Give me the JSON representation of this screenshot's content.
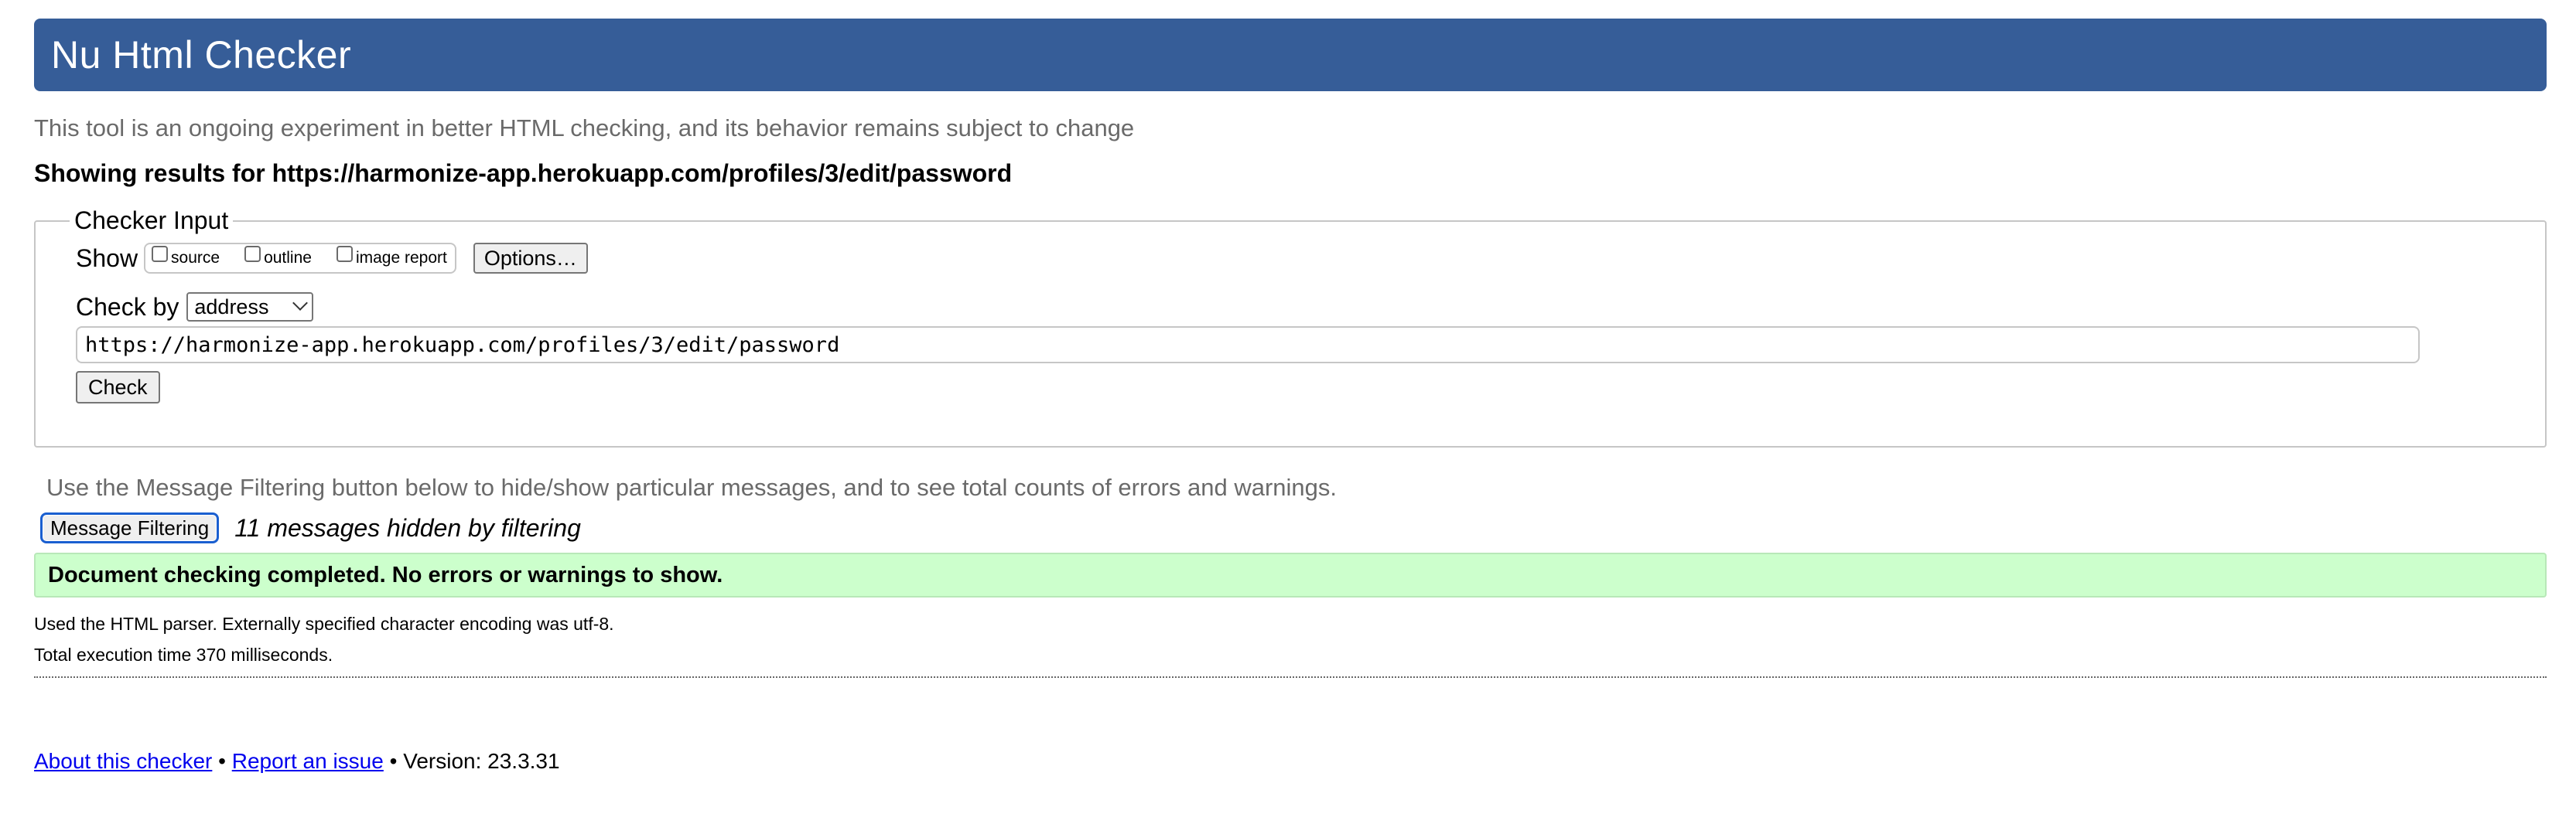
{
  "header": {
    "title": "Nu Html Checker"
  },
  "intro": "This tool is an ongoing experiment in better HTML checking, and its behavior remains subject to change",
  "results_for": "Showing results for https://harmonize-app.herokuapp.com/profiles/3/edit/password",
  "checker": {
    "legend": "Checker Input",
    "show_label": "Show",
    "show_options": [
      {
        "label": "source",
        "checked": false
      },
      {
        "label": "outline",
        "checked": false
      },
      {
        "label": "image report",
        "checked": false
      }
    ],
    "options_button": "Options…",
    "check_by_label": "Check by",
    "check_by_value": "address",
    "url_value": "https://harmonize-app.herokuapp.com/profiles/3/edit/password",
    "check_button": "Check"
  },
  "filtering": {
    "info": "Use the Message Filtering button below to hide/show particular messages, and to see total counts of errors and warnings.",
    "button": "Message Filtering",
    "hidden_count_text": "11 messages hidden by filtering"
  },
  "result": {
    "success": "Document checking completed. No errors or warnings to show.",
    "parser_info": "Used the HTML parser. Externally specified character encoding was utf-8.",
    "execution_time": "Total execution time 370 milliseconds."
  },
  "footer": {
    "about_link": "About this checker",
    "separator": " • ",
    "report_link": "Report an issue",
    "version": " • Version: 23.3.31"
  },
  "colors": {
    "banner": "#365d98",
    "success_bg": "#ccffcc",
    "link": "#0000ee",
    "focus_ring": "#1a5fd0"
  }
}
